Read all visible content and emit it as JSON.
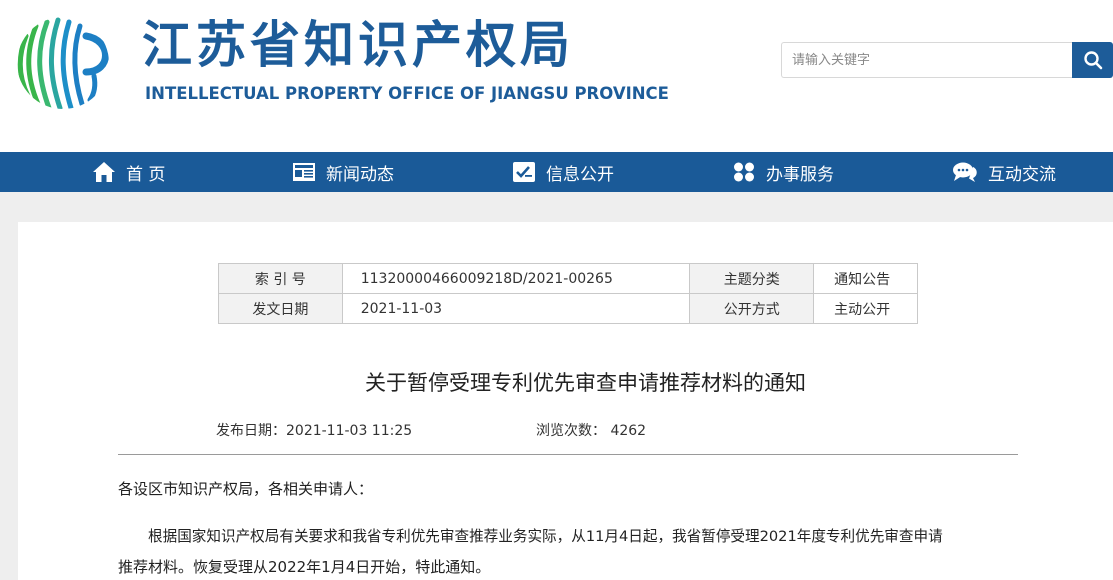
{
  "header": {
    "title": "江苏省知识产权局",
    "subtitle": "INTELLECTUAL PROPERTY OFFICE OF JIANGSU PROVINCE",
    "search_placeholder": "请输入关键字",
    "search_value": ""
  },
  "nav": {
    "items": [
      {
        "label": "首 页",
        "icon": "home-icon"
      },
      {
        "label": "新闻动态",
        "icon": "news-icon"
      },
      {
        "label": "信息公开",
        "icon": "info-icon"
      },
      {
        "label": "办事服务",
        "icon": "service-icon"
      },
      {
        "label": "互动交流",
        "icon": "chat-icon"
      }
    ]
  },
  "meta": {
    "index_label": "索 引 号",
    "index_value": "11320000466009218D/2021-00265",
    "category_label": "主题分类",
    "category_value": "通知公告",
    "date_label": "发文日期",
    "date_value": "2021-11-03",
    "method_label": "公开方式",
    "method_value": "主动公开"
  },
  "article": {
    "title": "关于暂停受理专利优先审查申请推荐材料的通知",
    "publish_label": "发布日期：",
    "publish_value": "2021-11-03 11:25",
    "views_label": "浏览次数：",
    "views_value": "4262",
    "salutation": "各设区市知识产权局，各相关申请人：",
    "body_line1": "根据国家知识产权局有关要求和我省专利优先审查推荐业务实际，从11月4日起，我省暂停受理2021年度专利优先审查申请",
    "body_line2": "推荐材料。恢复受理从2022年1月4日开始，特此通知。"
  },
  "colors": {
    "brand": "#1d5c99",
    "nav_bg": "#1a5a98",
    "logo_green": "#39b54a",
    "logo_blue": "#1d7fc4"
  }
}
